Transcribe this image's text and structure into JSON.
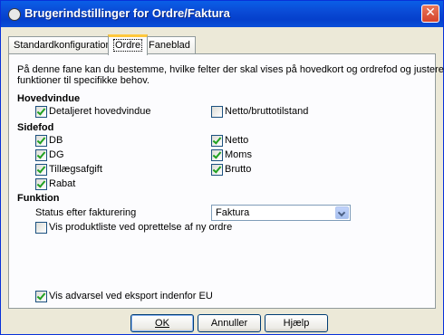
{
  "window": {
    "title": "Brugerindstillinger for Ordre/Faktura",
    "close_glyph": "✕"
  },
  "tabs": [
    {
      "label": "Standardkonfiguration",
      "active": false
    },
    {
      "label": "Ordre",
      "active": true
    },
    {
      "label": "Faneblad",
      "active": false
    }
  ],
  "panel": {
    "intro": "På denne fane kan du bestemme, hvilke felter der skal vises på hovedkort og ordrefod og justere funktioner til specifikke behov.",
    "intro_line1": "På denne fane kan du bestemme, hvilke felter der skal vises på hovedkort og ordrefod og justere",
    "intro_line2": "funktioner til specifikke behov.",
    "hovedvindue": {
      "header": "Hovedvindue",
      "items": [
        {
          "label": "Detaljeret hovedvindue",
          "checked": true
        },
        {
          "label": "Netto/bruttotilstand",
          "checked": false
        }
      ]
    },
    "sidefod": {
      "header": "Sidefod",
      "left": [
        {
          "label": "DB",
          "checked": true
        },
        {
          "label": "DG",
          "checked": true
        },
        {
          "label": "Tillægsafgift",
          "checked": true
        },
        {
          "label": "Rabat",
          "checked": true
        }
      ],
      "right": [
        {
          "label": "Netto",
          "checked": true
        },
        {
          "label": "Moms",
          "checked": true
        },
        {
          "label": "Brutto",
          "checked": true
        }
      ]
    },
    "funktion": {
      "header": "Funktion",
      "status_label": "Status efter fakturering",
      "status_value": "Faktura",
      "produktliste": {
        "label": "Vis produktliste ved oprettelse af ny ordre",
        "checked": false
      }
    },
    "eu_warning": {
      "label": "Vis advarsel ved eksport indenfor EU",
      "checked": true
    }
  },
  "buttons": {
    "ok": "OK",
    "cancel": "Annuller",
    "help": "Hjælp"
  }
}
